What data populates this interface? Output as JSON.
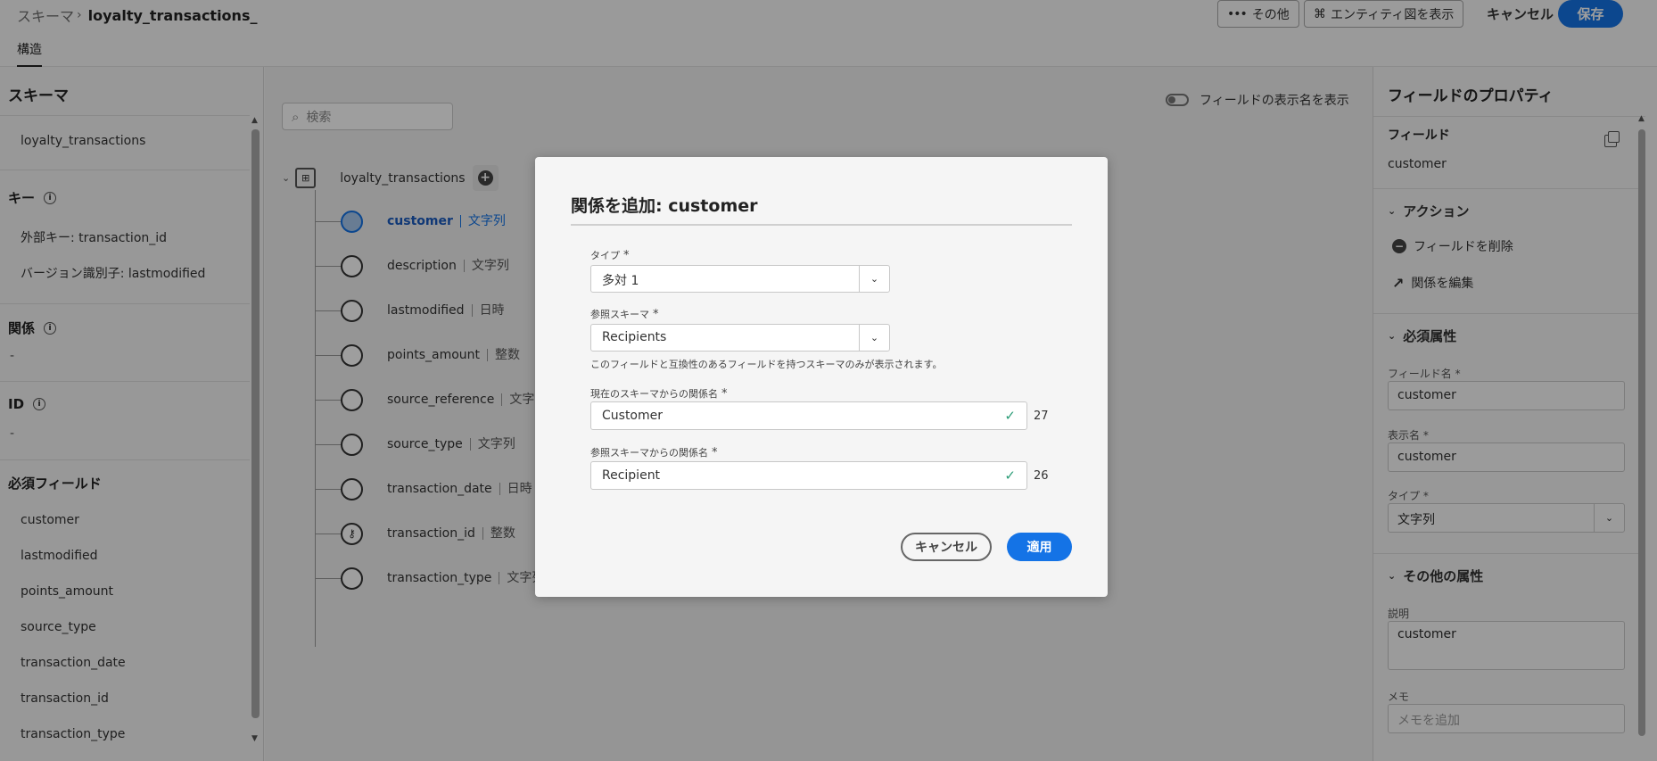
{
  "header": {
    "breadcrumb_root": "スキーマ",
    "breadcrumb_current": "loyalty_transactions_",
    "tab_label": "構造",
    "more_label": "その他",
    "entity_label": "エンティティ図を表示",
    "cancel_label": "キャンセル",
    "save_label": "保存"
  },
  "left": {
    "title": "スキーマ",
    "schema_name": "loyalty_transactions",
    "keys_title": "キー",
    "foreign_key": "外部キー: transaction_id",
    "version_id": "バージョン識別子: lastmodified",
    "relations_title": "関係",
    "relations_value": "-",
    "id_title": "ID",
    "id_value": "-",
    "required_title": "必須フィールド",
    "required_fields": [
      "customer",
      "lastmodified",
      "points_amount",
      "source_type",
      "transaction_date",
      "transaction_id",
      "transaction_type"
    ]
  },
  "center": {
    "search_placeholder": "検索",
    "toggle_label": "フィールドの表示名を表示",
    "root_name": "loyalty_transactions",
    "fields": [
      {
        "name": "customer",
        "type": "文字列"
      },
      {
        "name": "description",
        "type": "文字列"
      },
      {
        "name": "lastmodified",
        "type": "日時"
      },
      {
        "name": "points_amount",
        "type": "整数"
      },
      {
        "name": "source_reference",
        "type": "文字列"
      },
      {
        "name": "source_type",
        "type": "文字列"
      },
      {
        "name": "transaction_date",
        "type": "日時"
      },
      {
        "name": "transaction_id",
        "type": "整数"
      },
      {
        "name": "transaction_type",
        "type": "文字列"
      }
    ]
  },
  "right": {
    "title": "フィールドのプロパティ",
    "field_label": "フィールド",
    "field_value": "customer",
    "actions_title": "アクション",
    "delete_field": "フィールドを削除",
    "edit_relation": "関係を編集",
    "required_attrs_title": "必須属性",
    "field_name_label": "フィールド名",
    "field_name_value": "customer",
    "display_name_label": "表示名",
    "display_name_value": "customer",
    "type_label": "タイプ",
    "type_value": "文字列",
    "other_attrs_title": "その他の属性",
    "description_label": "説明",
    "description_value": "customer",
    "memo_label": "メモ",
    "memo_placeholder": "メモを追加"
  },
  "modal": {
    "title": "関係を追加: customer",
    "type_label": "タイプ",
    "type_value": "多対 1",
    "ref_schema_label": "参照スキーマ",
    "ref_schema_value": "Recipients",
    "hint": "このフィールドと互換性のあるフィールドを持つスキーマのみが表示されます。",
    "current_rel_label": "現在のスキーマからの関係名",
    "current_rel_value": "Customer",
    "current_rel_count": "27",
    "ref_rel_label": "参照スキーマからの関係名",
    "ref_rel_value": "Recipient",
    "ref_rel_count": "26",
    "cancel_label": "キャンセル",
    "apply_label": "適用"
  }
}
